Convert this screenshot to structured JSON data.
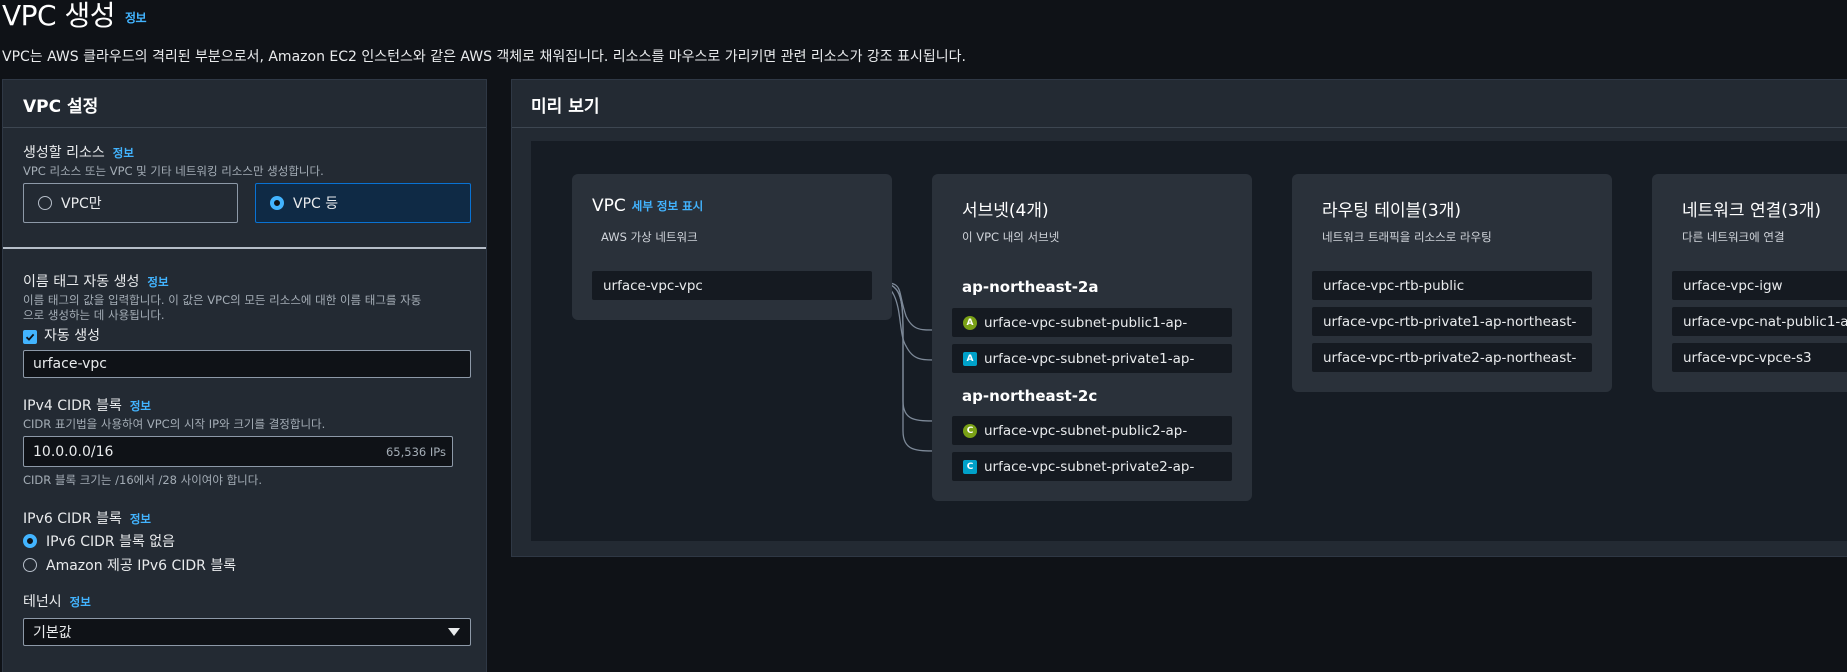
{
  "page": {
    "title": "VPC 생성",
    "info": "정보",
    "description": "VPC는 AWS 클라우드의 격리된 부분으로서, Amazon EC2 인스턴스와 같은 AWS 객체로 채워집니다. 리소스를 마우스로 가리키면 관련 리소스가 강조 표시됩니다."
  },
  "settings": {
    "title": "VPC 설정",
    "resources": {
      "label": "생성할 리소스",
      "info": "정보",
      "hint": "VPC 리소스 또는 VPC 및 기타 네트워킹 리소스만 생성합니다.",
      "option_vpc_only": "VPC만",
      "option_vpc_more": "VPC 등",
      "selected": "VPC 등"
    },
    "name_tag": {
      "label": "이름 태그 자동 생성",
      "info": "정보",
      "hint_line1": "이름 태그의 값을 입력합니다. 이 값은 VPC의 모든 리소스에 대한 이름 태그를 자동",
      "hint_line2": "으로 생성하는 데 사용됩니다.",
      "auto_label": "자동 생성",
      "auto_checked": true,
      "value": "urface-vpc"
    },
    "ipv4": {
      "label": "IPv4 CIDR 블록",
      "info": "정보",
      "hint": "CIDR 표기법을 사용하여 VPC의 시작 IP와 크기를 결정합니다.",
      "value": "10.0.0.0/16",
      "ip_count": "65,536 IPs",
      "constraint": "CIDR 블록 크기는 /16에서 /28 사이여야 합니다."
    },
    "ipv6": {
      "label": "IPv6 CIDR 블록",
      "info": "정보",
      "option_none": "IPv6 CIDR 블록 없음",
      "option_amazon": "Amazon 제공 IPv6 CIDR 블록",
      "selected": "IPv6 CIDR 블록 없음"
    },
    "tenancy": {
      "label": "테넌시",
      "info": "정보",
      "value": "기본값"
    }
  },
  "preview": {
    "title": "미리 보기",
    "vpc": {
      "title": "VPC",
      "link": "세부 정보 표시",
      "subtitle": "AWS 가상 네트워크",
      "node": "urface-vpc-vpc"
    },
    "subnets": {
      "title": "서브넷(4개)",
      "subtitle": "이 VPC 내의 서브넷",
      "groups": [
        {
          "az": "ap-northeast-2a",
          "items": [
            {
              "badge": "A",
              "kind": "public",
              "name": "urface-vpc-subnet-public1-ap-"
            },
            {
              "badge": "A",
              "kind": "private",
              "name": "urface-vpc-subnet-private1-ap-"
            }
          ]
        },
        {
          "az": "ap-northeast-2c",
          "items": [
            {
              "badge": "C",
              "kind": "public",
              "name": "urface-vpc-subnet-public2-ap-"
            },
            {
              "badge": "C",
              "kind": "private",
              "name": "urface-vpc-subnet-private2-ap-"
            }
          ]
        }
      ]
    },
    "route_tables": {
      "title": "라우팅 테이블(3개)",
      "subtitle": "네트워크 트래픽을 리소스로 라우팅",
      "items": [
        "urface-vpc-rtb-public",
        "urface-vpc-rtb-private1-ap-northeast-",
        "urface-vpc-rtb-private2-ap-northeast-"
      ]
    },
    "connections": {
      "title": "네트워크 연결(3개)",
      "subtitle": "다른 네트워크에 연결",
      "items": [
        "urface-vpc-igw",
        "urface-vpc-nat-public1-a",
        "urface-vpc-vpce-s3"
      ]
    }
  },
  "colors": {
    "accent": "#42b4ff",
    "public_badge": "#7aa116",
    "private_badge": "#00a1c9",
    "background": "#0f1217",
    "panel": "#232a33"
  }
}
